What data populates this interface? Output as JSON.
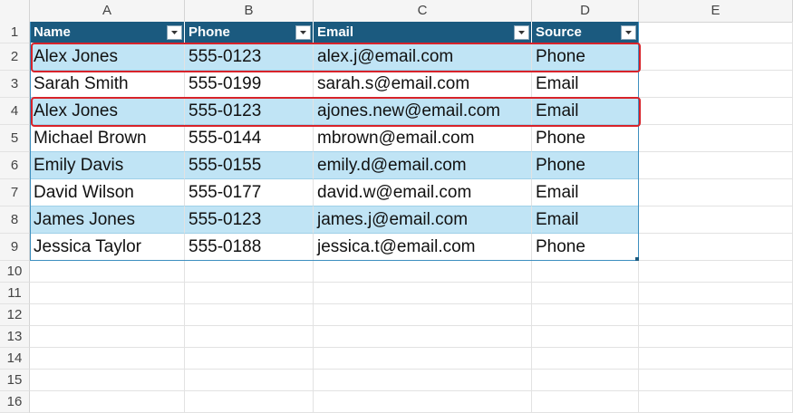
{
  "columns": [
    "A",
    "B",
    "C",
    "D",
    "E"
  ],
  "row_numbers": [
    "1",
    "2",
    "3",
    "4",
    "5",
    "6",
    "7",
    "8",
    "9",
    "10",
    "11",
    "12",
    "13",
    "14",
    "15",
    "16"
  ],
  "table": {
    "headers": [
      "Name",
      "Phone",
      "Email",
      "Source"
    ],
    "rows": [
      [
        "Alex Jones",
        "555-0123",
        "alex.j@email.com",
        "Phone"
      ],
      [
        "Sarah Smith",
        "555-0199",
        "sarah.s@email.com",
        "Email"
      ],
      [
        "Alex Jones",
        "555-0123",
        "ajones.new@email.com",
        "Email"
      ],
      [
        "Michael Brown",
        "555-0144",
        "mbrown@email.com",
        "Phone"
      ],
      [
        "Emily Davis",
        "555-0155",
        "emily.d@email.com",
        "Phone"
      ],
      [
        "David Wilson",
        "555-0177",
        "david.w@email.com",
        "Email"
      ],
      [
        "James Jones",
        "555-0123",
        "james.j@email.com",
        "Email"
      ],
      [
        "Jessica Taylor",
        "555-0188",
        "jessica.t@email.com",
        "Phone"
      ]
    ]
  },
  "highlighted_rows": [
    2,
    4
  ],
  "colors": {
    "header_fill": "#1b5a7f",
    "band_fill": "#c0e4f5",
    "highlight_outline": "#d8232a"
  }
}
